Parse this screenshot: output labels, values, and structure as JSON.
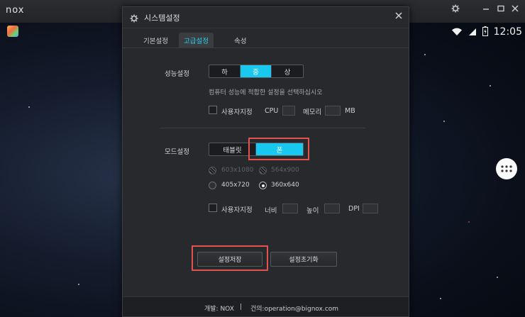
{
  "emulator": {
    "logo": "nox",
    "clock": "12:05"
  },
  "dialog": {
    "title": "시스템설정",
    "tabs": [
      {
        "label": "기본설정",
        "active": false
      },
      {
        "label": "고급설정",
        "active": true
      },
      {
        "label": "속성",
        "active": false
      }
    ],
    "performance": {
      "label": "성능설정",
      "options": [
        "하",
        "중",
        "상"
      ],
      "selected": "중",
      "hint": "컴퓨터 성능에 적합한 설정을 선택하십시오",
      "custom_label": "사용자지정",
      "cpu_label": "CPU",
      "memory_label": "메모리",
      "memory_unit": "MB"
    },
    "mode": {
      "label": "모드설정",
      "options": [
        "태블릿",
        "폰"
      ],
      "selected": "폰",
      "resolutions": [
        {
          "label": "603x1080",
          "state": "disabled"
        },
        {
          "label": "564x900",
          "state": "disabled"
        },
        {
          "label": "405x720",
          "state": "unchecked"
        },
        {
          "label": "360x640",
          "state": "checked"
        }
      ],
      "custom_label": "사용자지정",
      "width_label": "너비",
      "height_label": "높이",
      "dpi_label": "DPI"
    },
    "buttons": {
      "save": "설정저장",
      "reset": "설정초기화"
    },
    "footer": {
      "developer": "개발: NOX",
      "separator": "|",
      "contact": "건의:operation@bignox.com"
    }
  },
  "colors": {
    "accent": "#19c8ee",
    "highlight": "#e2524f",
    "dialog_bg": "#27292c"
  }
}
